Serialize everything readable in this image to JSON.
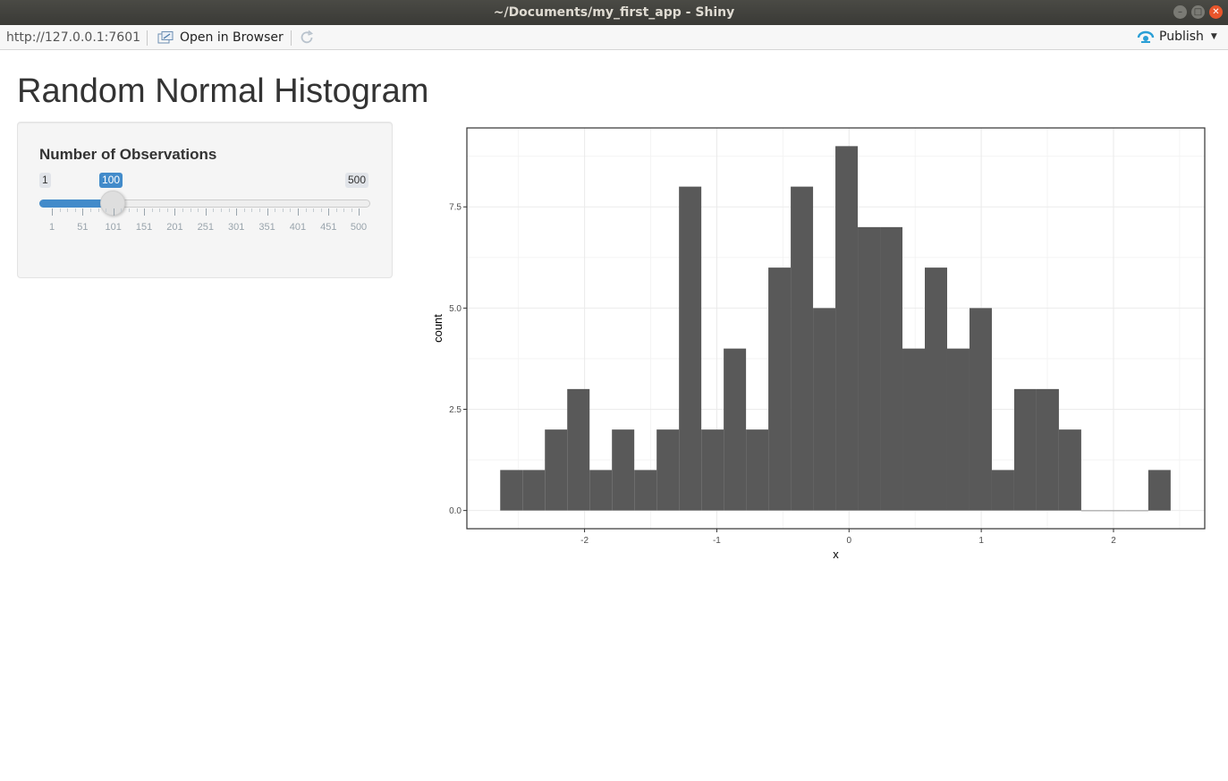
{
  "window": {
    "title": "~/Documents/my_first_app - Shiny"
  },
  "toolbar": {
    "url": "http://127.0.0.1:7601",
    "open_in_browser_label": "Open in Browser",
    "publish_label": "Publish"
  },
  "page": {
    "title": "Random Normal Histogram"
  },
  "sidebar": {
    "slider": {
      "label": "Number of Observations",
      "min": 1,
      "max": 500,
      "value": 100,
      "min_label": "1",
      "max_label": "500",
      "value_label": "100",
      "grid_labels": [
        "1",
        "51",
        "101",
        "151",
        "201",
        "251",
        "301",
        "351",
        "401",
        "451",
        "500"
      ]
    }
  },
  "colors": {
    "accent": "#428bca",
    "bar_fill": "#595959",
    "close_button": "#e8552b"
  },
  "chart_data": {
    "type": "bar",
    "title": "",
    "xlabel": "x",
    "ylabel": "count",
    "bin_width": 0.169,
    "bin_start": -2.638,
    "counts": [
      1,
      1,
      2,
      3,
      1,
      2,
      1,
      2,
      8,
      2,
      4,
      2,
      6,
      8,
      5,
      9,
      7,
      7,
      4,
      6,
      4,
      5,
      1,
      3,
      3,
      2,
      0,
      0,
      0,
      1
    ],
    "xlim": [
      -2.89,
      2.69
    ],
    "ylim": [
      -0.45,
      9.45
    ],
    "x_ticks": [
      -2,
      -1,
      0,
      1,
      2
    ],
    "x_tick_labels": [
      "-2",
      "-1",
      "0",
      "1",
      "2"
    ],
    "y_ticks": [
      0,
      2.5,
      5,
      7.5
    ],
    "y_tick_labels": [
      "0.0",
      "2.5",
      "5.0",
      "7.5"
    ],
    "grid": true,
    "legend": "none"
  }
}
